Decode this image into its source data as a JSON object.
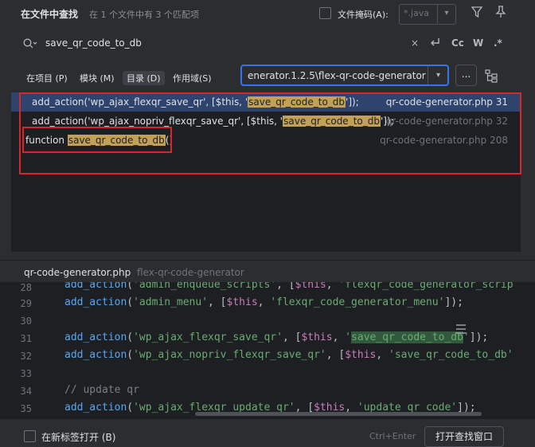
{
  "header": {
    "title": "在文件中查找",
    "summary": "在 1 个文件中有 3 个匹配项",
    "file_mask_label": "文件掩码(A):",
    "file_mask_value": "*.java"
  },
  "search": {
    "query": "save_qr_code_to_db",
    "clear": "×",
    "case_toggle": "Cc",
    "word_toggle": "W",
    "regex_toggle": ".*"
  },
  "scope": {
    "project": "在项目 (P)",
    "module": "模块 (M)",
    "directory": "目录 (D)",
    "scope": "作用域(S)",
    "directory_value": "enerator.1.2.5\\flex-qr-code-generator",
    "browse": "..."
  },
  "results": [
    {
      "pre": "add_action('wp_ajax_flexqr_save_qr', [$this, '",
      "match": "save_qr_code_to_db",
      "post": "']);",
      "file": "qr-code-generator.php 31"
    },
    {
      "pre": "add_action('wp_ajax_nopriv_flexqr_save_qr', [$this, '",
      "match": "save_qr_code_to_db",
      "post": "']);",
      "file": "qr-code-generator.php 32"
    },
    {
      "pre": "function ",
      "match": "save_qr_code_to_db",
      "post": "()",
      "file": "qr-code-generator.php 208"
    }
  ],
  "preview": {
    "file": "qr-code-generator.php",
    "dir": "flex-qr-code-generator"
  },
  "code": {
    "l28_num": "28",
    "l28_fn": "add_action",
    "l28_a": "(",
    "l28_s1": "'admin_enqueue_scripts'",
    "l28_b": ", [",
    "l28_v": "$this",
    "l28_c": ", ",
    "l28_s2": "'flexqr_code_generator_scrip",
    "l29_num": "29",
    "l29_fn": "add_action",
    "l29_a": "(",
    "l29_s1": "'admin_menu'",
    "l29_b": ", [",
    "l29_v": "$this",
    "l29_c": ", ",
    "l29_s2": "'flexqr_code_generator_menu'",
    "l29_d": "]);",
    "l30_num": "30",
    "l31_num": "31",
    "l31_fn": "add_action",
    "l31_a": "(",
    "l31_s1": "'wp_ajax_flexqr_save_qr'",
    "l31_b": ", [",
    "l31_v": "$this",
    "l31_c": ", ",
    "l31_q1": "'",
    "l31_hl": "save_qr_code_to_db",
    "l31_q2": "'",
    "l31_d": "]);",
    "l32_num": "32",
    "l32_fn": "add_action",
    "l32_a": "(",
    "l32_s1": "'wp_ajax_nopriv_flexqr_save_qr'",
    "l32_b": ", [",
    "l32_v": "$this",
    "l32_c": ", ",
    "l32_s2": "'save_qr_code_to_db'",
    "l33_num": "33",
    "l34_num": "34",
    "l34_cm": "// update qr",
    "l35_num": "35",
    "l35_fn": "add_action",
    "l35_a": "(",
    "l35_s1": "'wp_ajax_flexqr_update_qr'",
    "l35_b": ", [",
    "l35_v": "$this",
    "l35_c": ", ",
    "l35_s2": "'update_qr_code'",
    "l35_d": "]);"
  },
  "footer": {
    "new_tab_label": "在新标签打开 (B)",
    "shortcut": "Ctrl+Enter",
    "open_window": "打开查找窗口"
  },
  "colors": {
    "accent": "#3574f0",
    "match_highlight": "#c2a055",
    "annotation_red": "#d9262d",
    "selected_row": "#2e436e"
  },
  "icons": [
    "filter-icon",
    "pin-icon",
    "search-icon",
    "clear-icon",
    "regex-back-icon",
    "chevron-down-icon",
    "tree-view-icon",
    "fold-icon"
  ]
}
